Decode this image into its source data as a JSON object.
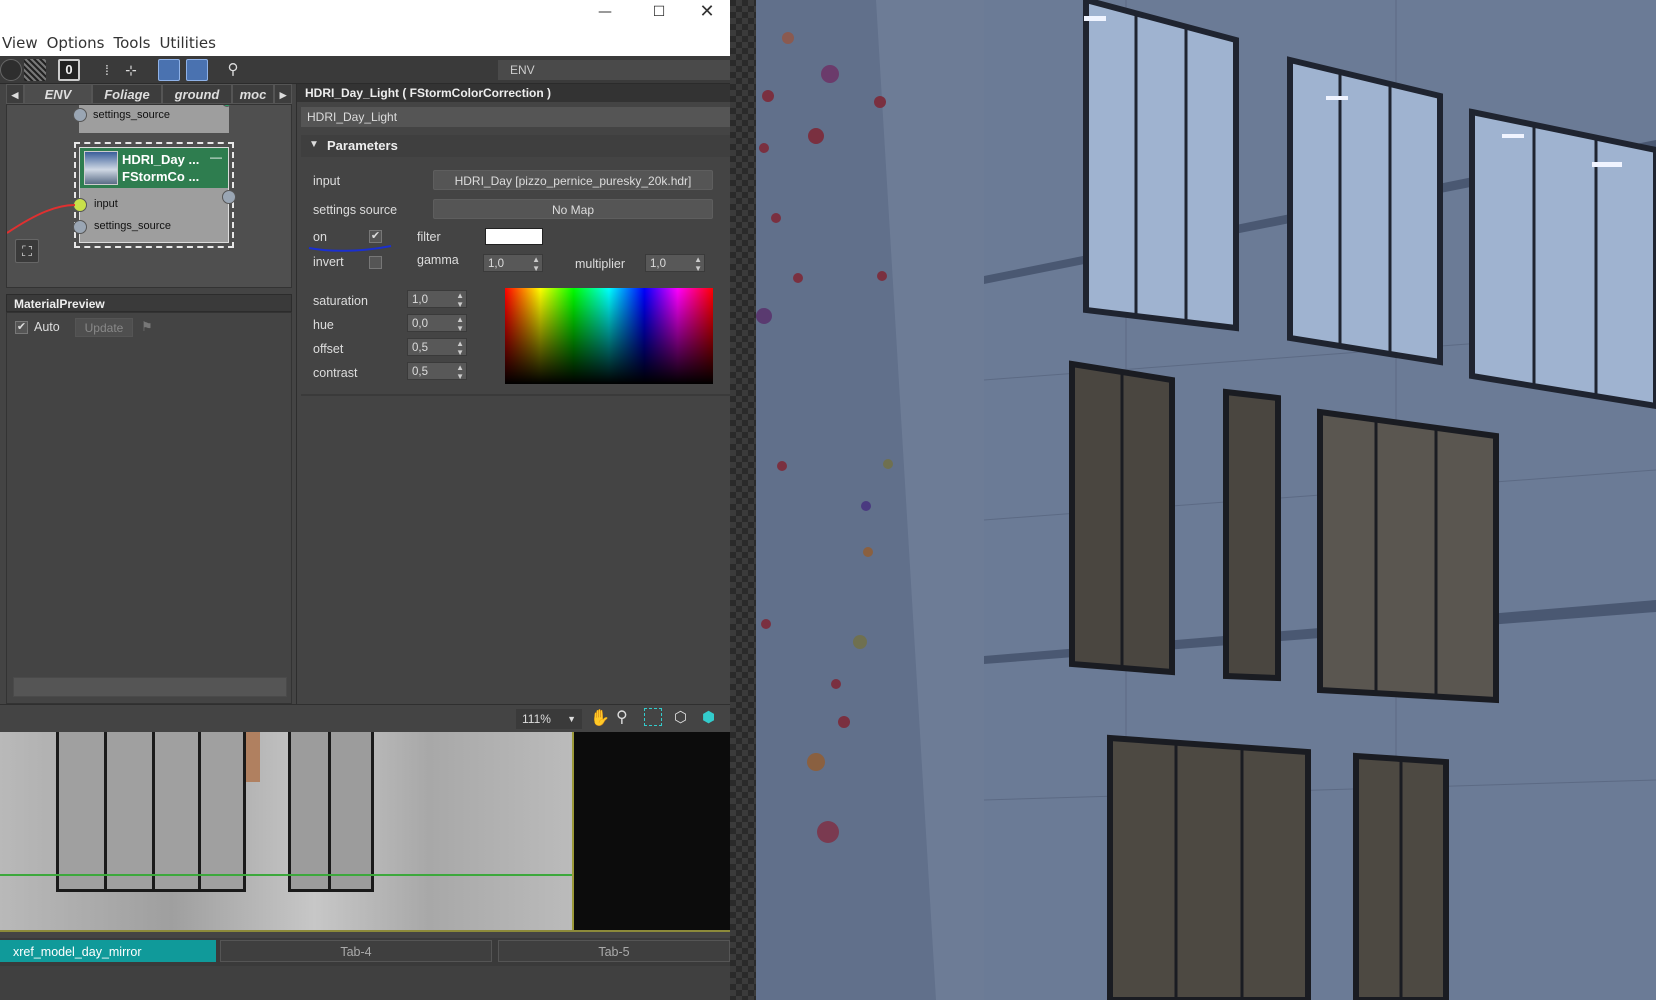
{
  "menu": [
    "View",
    "Options",
    "Tools",
    "Utilities"
  ],
  "toolbar": {
    "env_field": "ENV"
  },
  "view_tabs": [
    "ENV",
    "Foliage",
    "ground",
    "moc"
  ],
  "nodes": {
    "upper_socket": "settings_source",
    "main_title_1": "HDRI_Day ...",
    "main_title_2": "FStormCo ...",
    "socket_input": "input",
    "socket_settings": "settings_source"
  },
  "material_preview": {
    "title": "MaterialPreview",
    "auto_label": "Auto",
    "update_label": "Update",
    "auto_checked": true
  },
  "params": {
    "title": "HDRI_Day_Light  ( FStormColorCorrection )",
    "name_field": "HDRI_Day_Light",
    "section": "Parameters",
    "input_label": "input",
    "input_value": "HDRI_Day [pizzo_pernice_puresky_20k.hdr]",
    "settings_source_label": "settings source",
    "settings_source_value": "No Map",
    "on_label": "on",
    "filter_label": "filter",
    "invert_label": "invert",
    "gamma_label": "gamma",
    "gamma_value": "1,0",
    "multiplier_label": "multiplier",
    "multiplier_value": "1,0",
    "saturation_label": "saturation",
    "saturation_value": "1,0",
    "hue_label": "hue",
    "hue_value": "0,0",
    "offset_label": "offset",
    "offset_value": "0,5",
    "contrast_label": "contrast",
    "contrast_value": "0,5",
    "on_checked": true,
    "invert_checked": false,
    "filter_color": "#ffffff"
  },
  "status": {
    "zoom": "111%"
  },
  "bottom_tabs": [
    "xref_model_day_mirror",
    "Tab-4",
    "Tab-5"
  ],
  "colors": {
    "active_tab": "#109a9a",
    "node_header": "#2e7d4f",
    "connection": "#e03030",
    "annotation": "#1a2fd0"
  }
}
